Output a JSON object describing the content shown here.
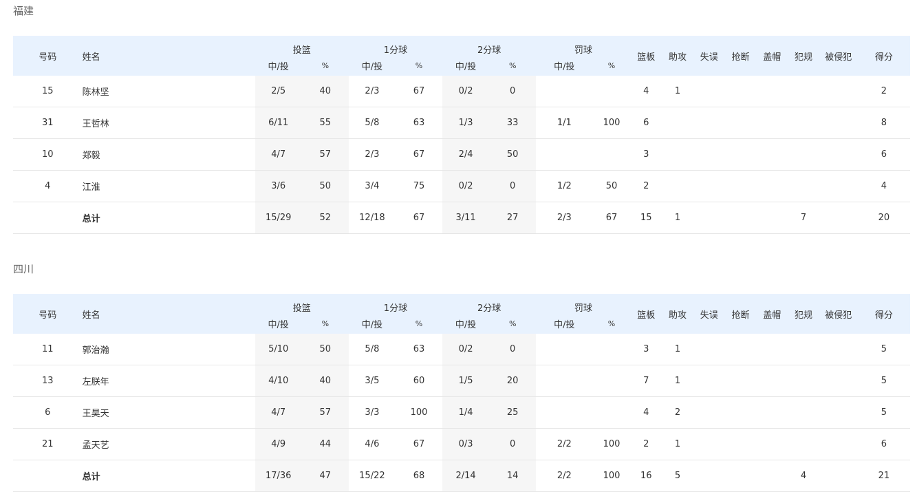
{
  "headers": {
    "number": "号码",
    "name": "姓名",
    "fg": "投篮",
    "one": "1分球",
    "two": "2分球",
    "ft": "罚球",
    "made_att": "中/投",
    "pct": "%",
    "reb": "篮板",
    "ast": "助攻",
    "tov": "失误",
    "stl": "抢断",
    "blk": "盖帽",
    "pf": "犯规",
    "fd": "被侵犯",
    "pts": "得分"
  },
  "teams": [
    {
      "name": "福建",
      "players": [
        {
          "no": "15",
          "name": "陈林坚",
          "fg": "2/5",
          "fg_pct": "40",
          "one": "2/3",
          "one_pct": "67",
          "two": "0/2",
          "two_pct": "0",
          "ft": "",
          "ft_pct": "",
          "reb": "4",
          "ast": "1",
          "tov": "",
          "stl": "",
          "blk": "",
          "pf": "",
          "fd": "",
          "pts": "2"
        },
        {
          "no": "31",
          "name": "王哲林",
          "fg": "6/11",
          "fg_pct": "55",
          "one": "5/8",
          "one_pct": "63",
          "two": "1/3",
          "two_pct": "33",
          "ft": "1/1",
          "ft_pct": "100",
          "reb": "6",
          "ast": "",
          "tov": "",
          "stl": "",
          "blk": "",
          "pf": "",
          "fd": "",
          "pts": "8"
        },
        {
          "no": "10",
          "name": "郑毅",
          "fg": "4/7",
          "fg_pct": "57",
          "one": "2/3",
          "one_pct": "67",
          "two": "2/4",
          "two_pct": "50",
          "ft": "",
          "ft_pct": "",
          "reb": "3",
          "ast": "",
          "tov": "",
          "stl": "",
          "blk": "",
          "pf": "",
          "fd": "",
          "pts": "6"
        },
        {
          "no": "4",
          "name": "江淮",
          "fg": "3/6",
          "fg_pct": "50",
          "one": "3/4",
          "one_pct": "75",
          "two": "0/2",
          "two_pct": "0",
          "ft": "1/2",
          "ft_pct": "50",
          "reb": "2",
          "ast": "",
          "tov": "",
          "stl": "",
          "blk": "",
          "pf": "",
          "fd": "",
          "pts": "4"
        }
      ],
      "total": {
        "no": "",
        "name": "总计",
        "fg": "15/29",
        "fg_pct": "52",
        "one": "12/18",
        "one_pct": "67",
        "two": "3/11",
        "two_pct": "27",
        "ft": "2/3",
        "ft_pct": "67",
        "reb": "15",
        "ast": "1",
        "tov": "",
        "stl": "",
        "blk": "",
        "pf": "7",
        "fd": "",
        "pts": "20"
      }
    },
    {
      "name": "四川",
      "players": [
        {
          "no": "11",
          "name": "郭治瀚",
          "fg": "5/10",
          "fg_pct": "50",
          "one": "5/8",
          "one_pct": "63",
          "two": "0/2",
          "two_pct": "0",
          "ft": "",
          "ft_pct": "",
          "reb": "3",
          "ast": "1",
          "tov": "",
          "stl": "",
          "blk": "",
          "pf": "",
          "fd": "",
          "pts": "5"
        },
        {
          "no": "13",
          "name": "左朕年",
          "fg": "4/10",
          "fg_pct": "40",
          "one": "3/5",
          "one_pct": "60",
          "two": "1/5",
          "two_pct": "20",
          "ft": "",
          "ft_pct": "",
          "reb": "7",
          "ast": "1",
          "tov": "",
          "stl": "",
          "blk": "",
          "pf": "",
          "fd": "",
          "pts": "5"
        },
        {
          "no": "6",
          "name": "王昊天",
          "fg": "4/7",
          "fg_pct": "57",
          "one": "3/3",
          "one_pct": "100",
          "two": "1/4",
          "two_pct": "25",
          "ft": "",
          "ft_pct": "",
          "reb": "4",
          "ast": "2",
          "tov": "",
          "stl": "",
          "blk": "",
          "pf": "",
          "fd": "",
          "pts": "5"
        },
        {
          "no": "21",
          "name": "孟天艺",
          "fg": "4/9",
          "fg_pct": "44",
          "one": "4/6",
          "one_pct": "67",
          "two": "0/3",
          "two_pct": "0",
          "ft": "2/2",
          "ft_pct": "100",
          "reb": "2",
          "ast": "1",
          "tov": "",
          "stl": "",
          "blk": "",
          "pf": "",
          "fd": "",
          "pts": "6"
        }
      ],
      "total": {
        "no": "",
        "name": "总计",
        "fg": "17/36",
        "fg_pct": "47",
        "one": "15/22",
        "one_pct": "68",
        "two": "2/14",
        "two_pct": "14",
        "ft": "2/2",
        "ft_pct": "100",
        "reb": "16",
        "ast": "5",
        "tov": "",
        "stl": "",
        "blk": "",
        "pf": "4",
        "fd": "",
        "pts": "21"
      }
    }
  ]
}
